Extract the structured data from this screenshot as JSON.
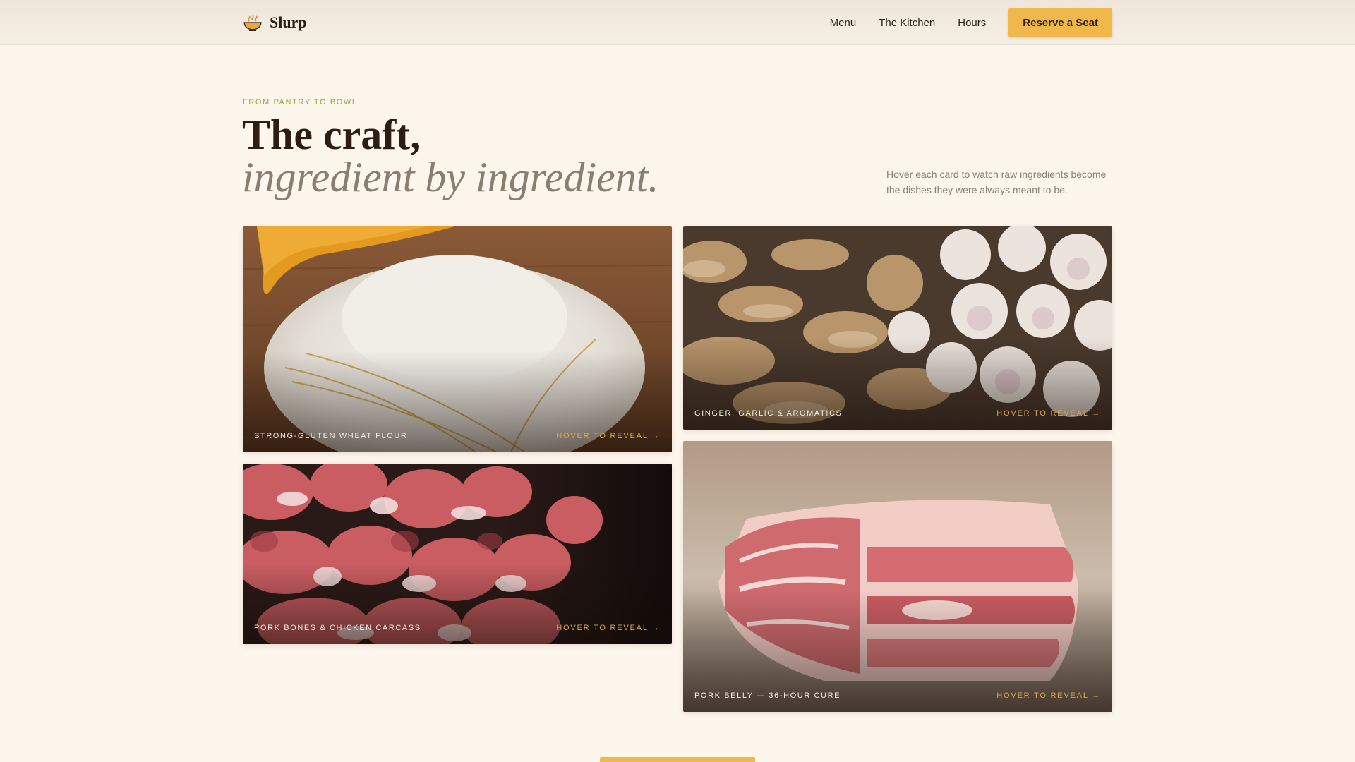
{
  "nav": {
    "brand": "Slurp",
    "brand_icon": "ramen-bowl-icon",
    "links": [
      "Menu",
      "The Kitchen",
      "Hours"
    ],
    "cta": "Reserve a Seat"
  },
  "hero": {
    "eyebrow": "FROM PANTRY TO BOWL",
    "title_line1": "The craft,",
    "title_line2": "ingredient by ingredient.",
    "description": "Hover each card to watch raw ingredients become the dishes they were always meant to be."
  },
  "cards": [
    {
      "label": "STRONG-GLUTEN WHEAT FLOUR",
      "hint": "HOVER TO REVEAL →",
      "image": "flour-with-wheat-and-wooden-scoop"
    },
    {
      "label": "GINGER, GARLIC & AROMATICS",
      "hint": "HOVER TO REVEAL →",
      "image": "ginger-and-garlic-pile"
    },
    {
      "label": "PORK BONES & CHICKEN CARCASS",
      "hint": "HOVER TO REVEAL →",
      "image": "raw-pork-pieces"
    },
    {
      "label": "PORK BELLY — 36-HOUR CURE",
      "hint": "HOVER TO REVEAL →",
      "image": "raw-pork-belly-slab"
    }
  ],
  "colors": {
    "background": "#fdf6ec",
    "accent": "#f0b84a",
    "eyebrow": "#8fa83a",
    "muted_text": "#8a7e71",
    "hint": "#d9a94a"
  }
}
